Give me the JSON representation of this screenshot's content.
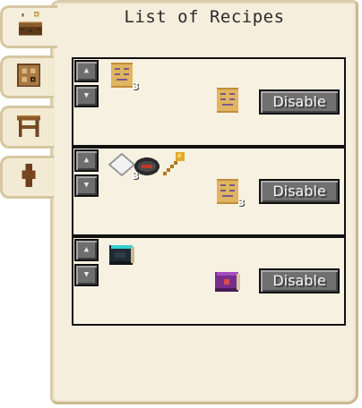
{
  "title": "List of Recipes",
  "tabs": [
    {
      "name": "cake-icon",
      "active": true
    },
    {
      "name": "recipe-board-icon",
      "active": false
    },
    {
      "name": "crafting-table-icon",
      "active": false
    },
    {
      "name": "person-icon",
      "active": false
    }
  ],
  "arrow_up_label": "▲",
  "arrow_down_label": "▼",
  "disable_label": "Disable",
  "recipes": [
    {
      "inputs": [
        {
          "icon": "recipe-scroll-icon",
          "count": "3"
        }
      ],
      "output": {
        "icon": "recipe-scroll-icon",
        "count": ""
      }
    },
    {
      "inputs": [
        {
          "icon": "paper-icon",
          "count": "3"
        },
        {
          "icon": "compass-icon",
          "count": ""
        },
        {
          "icon": "golden-spoon-icon",
          "count": ""
        }
      ],
      "output": {
        "icon": "recipe-scroll-icon",
        "count": "3"
      }
    },
    {
      "inputs": [
        {
          "icon": "dark-book-icon",
          "count": ""
        }
      ],
      "output": {
        "icon": "purple-book-icon",
        "count": ""
      }
    }
  ],
  "colors": {
    "parchment": "#f5eedc",
    "button_gray": "#707070",
    "border": "#111111"
  }
}
